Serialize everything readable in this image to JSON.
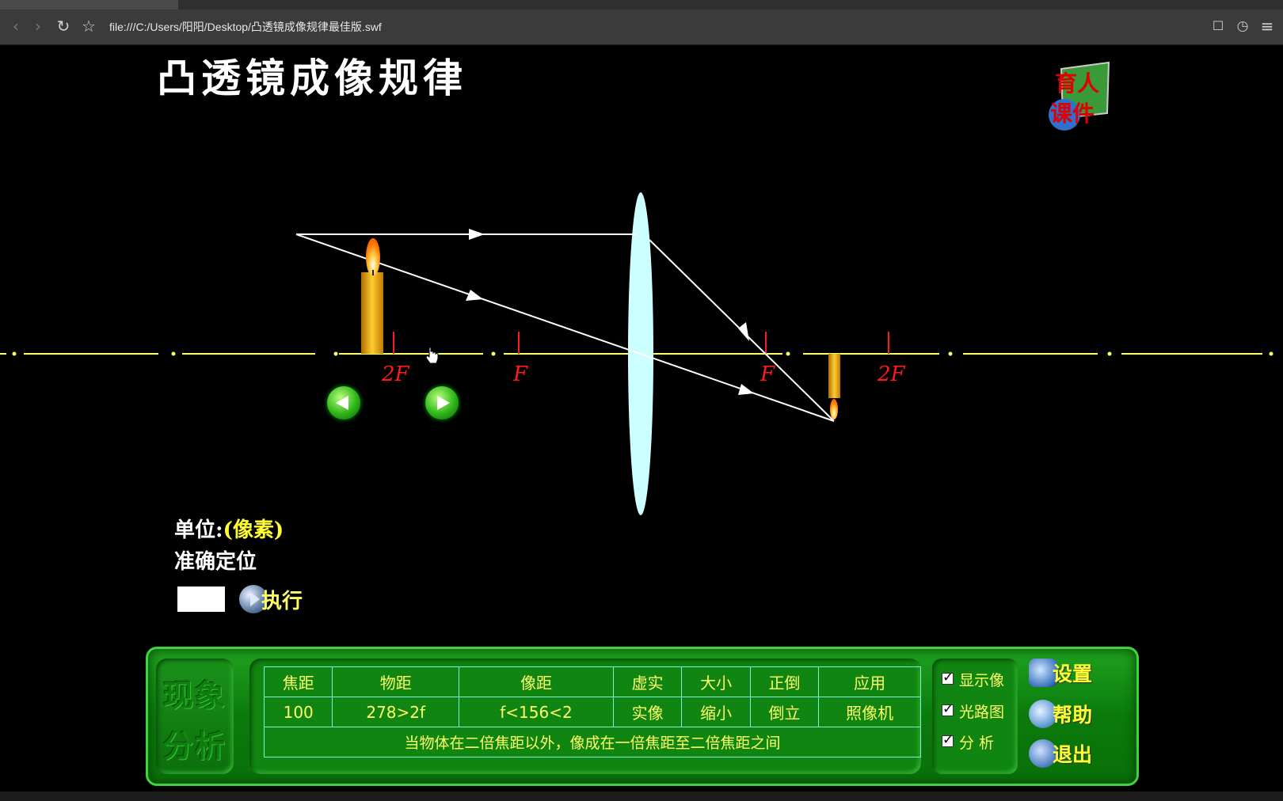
{
  "browser": {
    "url": "file:///C:/Users/阳阳/Desktop/凸透镜成像规律最佳版.swf",
    "icons": [
      "back-icon",
      "forward-icon",
      "reload-icon",
      "bookmark-star-icon",
      "share-icon",
      "history-icon",
      "menu-icon"
    ]
  },
  "page": {
    "title": "凸透镜成像规律",
    "logo": {
      "line1": "育人",
      "line2": "课件"
    }
  },
  "diagram": {
    "labels": {
      "two_f_left": "2F",
      "f_left": "F",
      "f_right": "F",
      "two_f_right": "2F"
    },
    "colors": {
      "axis": "#ffff66",
      "marks": "#ff1a1a",
      "rays": "#ffffff",
      "lens": "#ccffff"
    }
  },
  "controls": {
    "unit_label": "单位:",
    "unit_value": "(像素)",
    "locate_label": "准确定位",
    "position_value": "",
    "exec_label": "执行",
    "prev_icon": "arrow-left-icon",
    "next_icon": "arrow-right-icon"
  },
  "panel": {
    "label_line1": "现象",
    "label_line2": "分析",
    "headers": [
      "焦距",
      "物距",
      "像距",
      "虚实",
      "大小",
      "正倒",
      "应用"
    ],
    "values": [
      "100",
      "278>2f",
      "f<156<2",
      "实像",
      "缩小",
      "倒立",
      "照像机"
    ],
    "note": "当物体在二倍焦距以外，像成在一倍焦距至二倍焦距之间",
    "checks": [
      {
        "label": "显示像",
        "checked": true
      },
      {
        "label": "光路图",
        "checked": true
      },
      {
        "label": "分  析",
        "checked": true
      }
    ],
    "settings_label": "设置",
    "help_label": "帮助",
    "exit_label": "退出"
  }
}
